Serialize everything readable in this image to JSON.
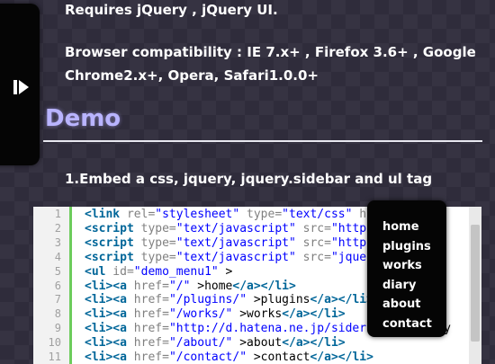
{
  "requirements": "Requires jQuery , jQuery UI.",
  "compatibility": "Browser compatibility : IE 7.x+ , Firefox 3.6+ , Google Chrome2.x+, Opera, Safari1.0.0+",
  "demo_heading": "Demo",
  "step1": "1.Embed a css, jquery, jquery.sidebar and ul tag",
  "sidebar": {
    "icon": "expand-arrow-icon"
  },
  "code": {
    "line_numbers": [
      "1",
      "2",
      "3",
      "4",
      "5",
      "6",
      "7",
      "8",
      "9",
      "10",
      "11"
    ],
    "lines": [
      [
        [
          "kw",
          "<link"
        ],
        [
          "at",
          " rel="
        ],
        [
          "st",
          "\"stylesheet\""
        ],
        [
          "at",
          " type="
        ],
        [
          "st",
          "\"text/css\""
        ],
        [
          "at",
          " href="
        ],
        [
          "st",
          "\"/"
        ]
      ],
      [
        [
          "kw",
          "<script"
        ],
        [
          "at",
          " type="
        ],
        [
          "st",
          "\"text/javascript\""
        ],
        [
          "at",
          " src="
        ],
        [
          "st",
          "\"http://code"
        ]
      ],
      [
        [
          "kw",
          "<script"
        ],
        [
          "at",
          " type="
        ],
        [
          "st",
          "\"text/javascript\""
        ],
        [
          "at",
          " src="
        ],
        [
          "st",
          "\"http://code"
        ]
      ],
      [
        [
          "kw",
          "<script"
        ],
        [
          "at",
          " type="
        ],
        [
          "st",
          "\"text/javascript\""
        ],
        [
          "at",
          " src="
        ],
        [
          "st",
          "\"jquery.sidebar"
        ]
      ],
      [
        [
          "kw",
          "<ul"
        ],
        [
          "at",
          " id="
        ],
        [
          "st",
          "\"demo_menu1\""
        ],
        [
          "tx",
          " >"
        ]
      ],
      [
        [
          "kw",
          "<li><a"
        ],
        [
          "at",
          " href="
        ],
        [
          "st",
          "\"/\""
        ],
        [
          "tx",
          " >home"
        ],
        [
          "kw",
          "</a></li>"
        ]
      ],
      [
        [
          "kw",
          "<li><a"
        ],
        [
          "at",
          " href="
        ],
        [
          "st",
          "\"/plugins/\""
        ],
        [
          "tx",
          " >plugins"
        ],
        [
          "kw",
          "</a></li>"
        ]
      ],
      [
        [
          "kw",
          "<li><a"
        ],
        [
          "at",
          " href="
        ],
        [
          "st",
          "\"/works/\""
        ],
        [
          "tx",
          " >works"
        ],
        [
          "kw",
          "</a></li>"
        ]
      ],
      [
        [
          "kw",
          "<li><a"
        ],
        [
          "at",
          " href="
        ],
        [
          "st",
          "\"http://d.hatena.ne.jp/sideroad/\""
        ],
        [
          "tx",
          " >diary"
        ]
      ],
      [
        [
          "kw",
          "<li><a"
        ],
        [
          "at",
          " href="
        ],
        [
          "st",
          "\"/about/\""
        ],
        [
          "tx",
          " >about"
        ],
        [
          "kw",
          "</a></li>"
        ]
      ],
      [
        [
          "kw",
          "<li><a"
        ],
        [
          "at",
          " href="
        ],
        [
          "st",
          "\"/contact/\""
        ],
        [
          "tx",
          " >contact"
        ],
        [
          "kw",
          "</a></li>"
        ]
      ]
    ]
  },
  "menu": {
    "items": [
      {
        "label": "home"
      },
      {
        "label": "plugins"
      },
      {
        "label": "works"
      },
      {
        "label": "diary"
      },
      {
        "label": "about"
      },
      {
        "label": "contact"
      }
    ]
  }
}
